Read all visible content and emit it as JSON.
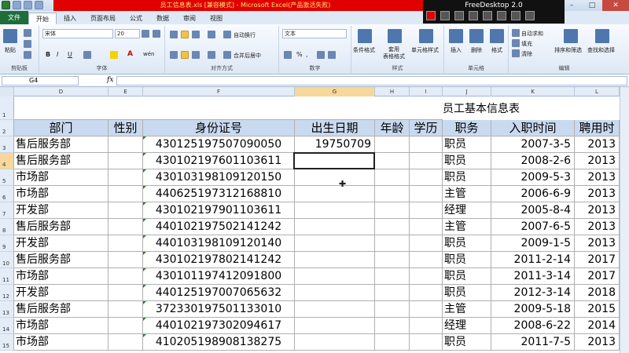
{
  "window": {
    "title": "员工信息表.xls  [兼容模式] - Microsoft Excel(产品激活失败)",
    "freedesktop_label": "FreeDesktop 2.0"
  },
  "tabs": [
    "文件",
    "开始",
    "插入",
    "页面布局",
    "公式",
    "数据",
    "审阅",
    "视图"
  ],
  "ribbon": {
    "clipboard": {
      "group": "剪贴板",
      "paste": "粘贴"
    },
    "font": {
      "group": "字体",
      "name": "宋体",
      "size": "20",
      "bold": "B",
      "italic": "I",
      "underline": "U",
      "font_color": "A",
      "wen": "wén"
    },
    "alignment": {
      "group": "对齐方式",
      "wrap": "自动换行",
      "merge": "合并后居中"
    },
    "number": {
      "group": "数字",
      "format": "文本",
      "percent": "%",
      "comma": ","
    },
    "styles": {
      "group": "样式",
      "cond": "条件格式",
      "table": "套用\n表格格式",
      "cell": "单元格样式"
    },
    "cells": {
      "group": "单元格",
      "insert": "插入",
      "delete": "删除",
      "format": "格式"
    },
    "editing": {
      "group": "编辑",
      "autosum": "自动求和",
      "fill": "填充",
      "clear": "清除",
      "sort": "排序和筛选",
      "find": "查找和选择"
    }
  },
  "formula_bar": {
    "name_box": "G4",
    "fx": "fx",
    "value": ""
  },
  "columns": [
    "D",
    "E",
    "F",
    "G",
    "H",
    "I",
    "J",
    "K",
    "L"
  ],
  "selected_column": "G",
  "rows": [
    "1",
    "2",
    "3",
    "4",
    "5",
    "6",
    "7",
    "8",
    "9",
    "10",
    "11",
    "12",
    "13",
    "14",
    "15"
  ],
  "selected_row": "4",
  "sheet": {
    "title": "员工基本信息表",
    "headers": [
      "部门",
      "性别",
      "身份证号",
      "出生日期",
      "年龄",
      "学历",
      "职务",
      "入职时间",
      "聘用时"
    ],
    "data": [
      [
        "售后服务部",
        "",
        "430125197507090050",
        "19750709",
        "",
        "",
        "职员",
        "2007-3-5",
        "2013"
      ],
      [
        "售后服务部",
        "",
        "430102197601103611",
        "",
        "",
        "",
        "职员",
        "2008-2-6",
        "2013"
      ],
      [
        "市场部",
        "",
        "430103198109120150",
        "",
        "",
        "",
        "职员",
        "2009-5-3",
        "2013"
      ],
      [
        "市场部",
        "",
        "440625197312168810",
        "",
        "",
        "",
        "主管",
        "2006-6-9",
        "2013"
      ],
      [
        "开发部",
        "",
        "430102197901103611",
        "",
        "",
        "",
        "经理",
        "2005-8-4",
        "2013"
      ],
      [
        "售后服务部",
        "",
        "440102197502141242",
        "",
        "",
        "",
        "主管",
        "2007-6-5",
        "2013"
      ],
      [
        "开发部",
        "",
        "440103198109120140",
        "",
        "",
        "",
        "职员",
        "2009-1-5",
        "2013"
      ],
      [
        "售后服务部",
        "",
        "430102197802141242",
        "",
        "",
        "",
        "职员",
        "2011-2-14",
        "2017"
      ],
      [
        "市场部",
        "",
        "430101197412091800",
        "",
        "",
        "",
        "职员",
        "2011-3-14",
        "2017"
      ],
      [
        "开发部",
        "",
        "440125197007065632",
        "",
        "",
        "",
        "职员",
        "2012-3-14",
        "2018"
      ],
      [
        "售后服务部",
        "",
        "372330197501133010",
        "",
        "",
        "",
        "主管",
        "2009-5-18",
        "2015"
      ],
      [
        "市场部",
        "",
        "440102197302094617",
        "",
        "",
        "",
        "经理",
        "2008-6-22",
        "2014"
      ],
      [
        "市场部",
        "",
        "410205198908138275",
        "",
        "",
        "",
        "职员",
        "2011-7-5",
        "2013"
      ]
    ]
  }
}
